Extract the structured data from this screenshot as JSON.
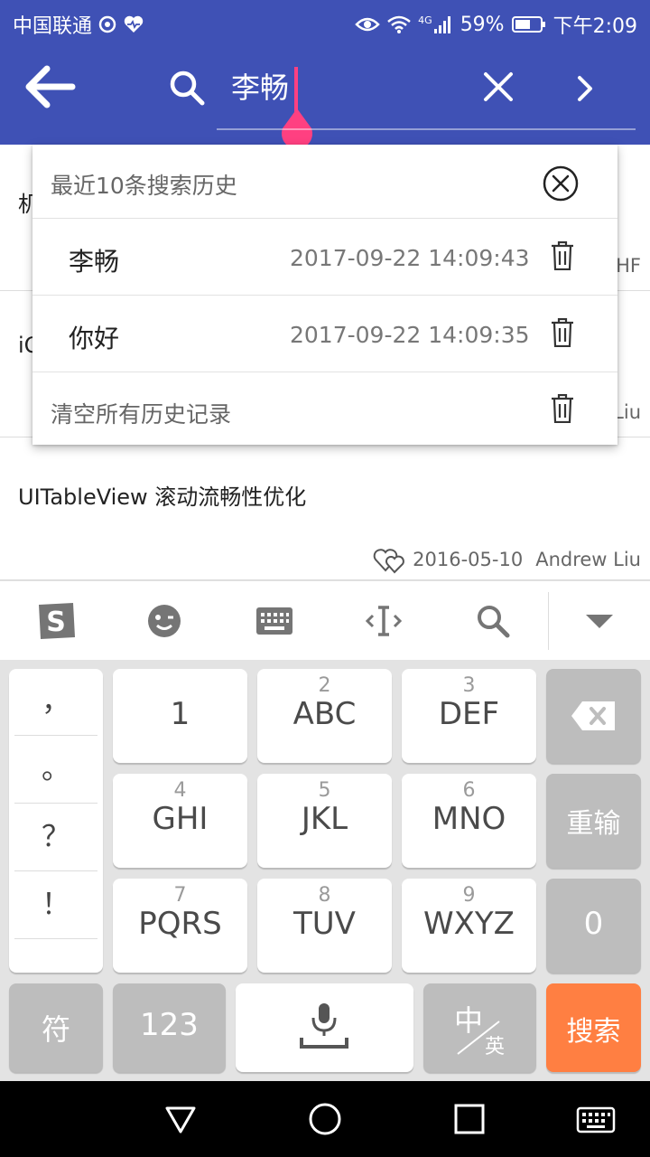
{
  "status_bar": {
    "carrier": "中国联通",
    "network": "4G",
    "battery": "59%",
    "time": "下午2:09"
  },
  "search": {
    "query": "李畅"
  },
  "history": {
    "title": "最近10条搜索历史",
    "items": [
      {
        "term": "李畅",
        "time": "2017-09-22 14:09:43"
      },
      {
        "term": "你好",
        "time": "2017-09-22 14:09:35"
      }
    ],
    "clear_all": "清空所有历史记录"
  },
  "articles": [
    {
      "title": "机",
      "date": "",
      "author": "HF"
    },
    {
      "title": "iO",
      "date": "",
      "author": "Liu"
    },
    {
      "title": "UITableView 滚动流畅性优化",
      "date": "2016-05-10",
      "author": "Andrew Liu"
    }
  ],
  "keyboard": {
    "punctuation": [
      "，",
      "。",
      "？",
      "！"
    ],
    "rows": [
      [
        {
          "sub": "",
          "main": "1"
        },
        {
          "sub": "2",
          "main": "ABC"
        },
        {
          "sub": "3",
          "main": "DEF"
        }
      ],
      [
        {
          "sub": "4",
          "main": "GHI"
        },
        {
          "sub": "5",
          "main": "JKL"
        },
        {
          "sub": "6",
          "main": "MNO"
        }
      ],
      [
        {
          "sub": "7",
          "main": "PQRS"
        },
        {
          "sub": "8",
          "main": "TUV"
        },
        {
          "sub": "9",
          "main": "WXYZ"
        }
      ]
    ],
    "reenter": "重输",
    "zero": "0",
    "symbols": "符",
    "numbers": "123",
    "lang_zh": "中",
    "lang_en": "英",
    "search": "搜索"
  },
  "colors": {
    "primary": "#3f51b5",
    "accent": "#ff4081",
    "search_key": "#ff7f42"
  },
  "icons": [
    "back-arrow-icon",
    "search-icon",
    "clear-icon",
    "chevron-right-icon",
    "close-circle-icon",
    "trash-icon",
    "sogou-logo-icon",
    "emoji-icon",
    "keyboard-icon",
    "cursor-move-icon",
    "collapse-icon",
    "backspace-icon",
    "microphone-icon",
    "nav-back-icon",
    "nav-home-icon",
    "nav-recents-icon"
  ]
}
